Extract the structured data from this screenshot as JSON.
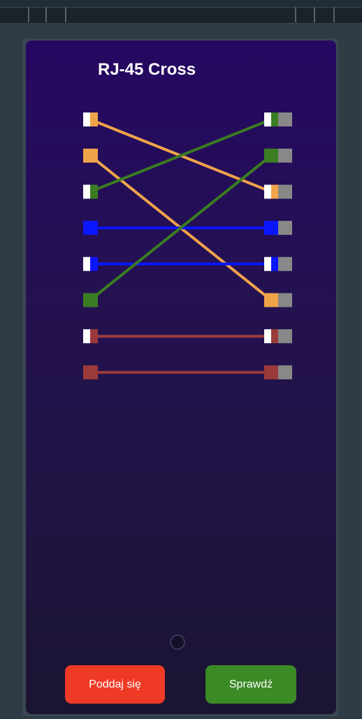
{
  "title": "RJ-45 Cross",
  "buttons": {
    "surrender": "Poddaj się",
    "check": "Sprawdź"
  },
  "colors": {
    "orange": "#f0a44a",
    "white": "#ffffff",
    "green": "#3a7d22",
    "blue": "#0a16ff",
    "brown": "#9b3a3a",
    "gray": "#888888"
  },
  "left_pins": [
    {
      "pin": 1,
      "color": "orange",
      "striped": true
    },
    {
      "pin": 2,
      "color": "orange",
      "striped": false
    },
    {
      "pin": 3,
      "color": "green",
      "striped": true
    },
    {
      "pin": 4,
      "color": "blue",
      "striped": false
    },
    {
      "pin": 5,
      "color": "blue",
      "striped": true
    },
    {
      "pin": 6,
      "color": "green",
      "striped": false
    },
    {
      "pin": 7,
      "color": "brown",
      "striped": true
    },
    {
      "pin": 8,
      "color": "brown",
      "striped": false
    }
  ],
  "right_pins": [
    {
      "pin": 1,
      "color": "green",
      "striped": true
    },
    {
      "pin": 2,
      "color": "green",
      "striped": false
    },
    {
      "pin": 3,
      "color": "orange",
      "striped": true
    },
    {
      "pin": 4,
      "color": "blue",
      "striped": false
    },
    {
      "pin": 5,
      "color": "blue",
      "striped": true
    },
    {
      "pin": 6,
      "color": "orange",
      "striped": false
    },
    {
      "pin": 7,
      "color": "brown",
      "striped": true
    },
    {
      "pin": 8,
      "color": "brown",
      "striped": false
    }
  ],
  "connections": [
    {
      "from": 1,
      "to": 3,
      "color": "orange"
    },
    {
      "from": 2,
      "to": 6,
      "color": "orange"
    },
    {
      "from": 3,
      "to": 1,
      "color": "green"
    },
    {
      "from": 4,
      "to": 4,
      "color": "blue"
    },
    {
      "from": 5,
      "to": 5,
      "color": "blue"
    },
    {
      "from": 6,
      "to": 2,
      "color": "green"
    },
    {
      "from": 7,
      "to": 7,
      "color": "brown"
    },
    {
      "from": 8,
      "to": 8,
      "color": "brown"
    }
  ]
}
